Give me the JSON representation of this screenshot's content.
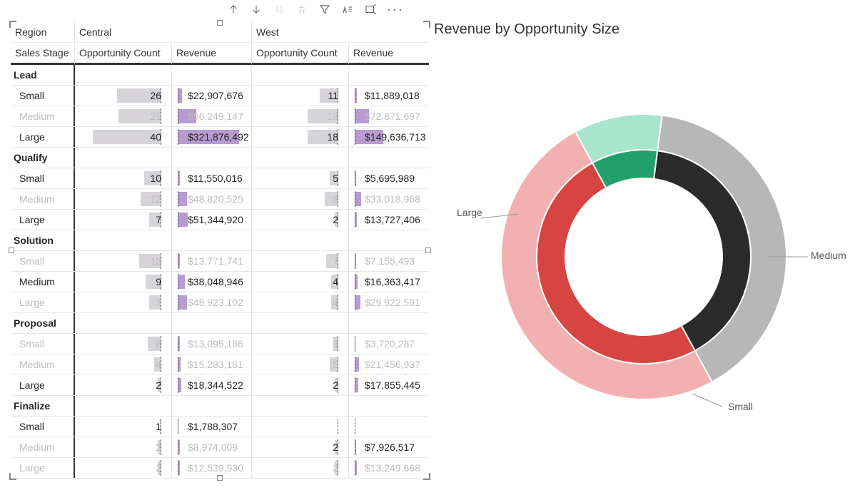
{
  "toolbar": {
    "icons": [
      "drill-up",
      "drill-down",
      "drill-hierarchy",
      "expand-down",
      "filter",
      "spotlight",
      "focus",
      "more"
    ]
  },
  "matrix": {
    "cornerLabels": {
      "region": "Region",
      "salesStage": "Sales Stage"
    },
    "regions": [
      "Central",
      "West"
    ],
    "metrics": [
      "Opportunity Count",
      "Revenue"
    ],
    "rows": [
      {
        "type": "group",
        "label": "Lead"
      },
      {
        "type": "data",
        "label": "Small",
        "dim": false,
        "c_cnt": 26,
        "c_rev": "$22,907,676",
        "w_cnt": 11,
        "w_rev": "$11,889,018",
        "c_cnt_bar": 0.52,
        "w_cnt_bar": 0.22,
        "c_rev_bar": 0.07,
        "w_rev_bar": 0.04
      },
      {
        "type": "data",
        "label": "Medium",
        "dim": true,
        "c_cnt": 25,
        "c_rev": "$96,249,147",
        "w_cnt": 18,
        "w_rev": "$72,871,697",
        "c_cnt_bar": 0.5,
        "w_cnt_bar": 0.36,
        "c_rev_bar": 0.3,
        "w_rev_bar": 0.23
      },
      {
        "type": "data",
        "label": "Large",
        "dim": false,
        "c_cnt": 40,
        "c_rev": "$321,876,492",
        "w_cnt": 18,
        "w_rev": "$149,636,713",
        "c_cnt_bar": 0.8,
        "w_cnt_bar": 0.36,
        "c_rev_bar": 1.0,
        "w_rev_bar": 0.46
      },
      {
        "type": "group",
        "label": "Qualify"
      },
      {
        "type": "data",
        "label": "Small",
        "dim": false,
        "c_cnt": 10,
        "c_rev": "$11,550,016",
        "w_cnt": 5,
        "w_rev": "$5,695,989",
        "c_cnt_bar": 0.2,
        "w_cnt_bar": 0.1,
        "c_rev_bar": 0.04,
        "w_rev_bar": 0.02
      },
      {
        "type": "data",
        "label": "Medium",
        "dim": true,
        "c_cnt": 12,
        "c_rev": "$48,820,525",
        "w_cnt": 8,
        "w_rev": "$33,018,968",
        "c_cnt_bar": 0.24,
        "w_cnt_bar": 0.16,
        "c_rev_bar": 0.15,
        "w_rev_bar": 0.1
      },
      {
        "type": "data",
        "label": "Large",
        "dim": false,
        "c_cnt": 7,
        "c_rev": "$51,344,920",
        "w_cnt": 2,
        "w_rev": "$13,727,406",
        "c_cnt_bar": 0.14,
        "w_cnt_bar": 0.04,
        "c_rev_bar": 0.16,
        "w_rev_bar": 0.04
      },
      {
        "type": "group",
        "label": "Solution"
      },
      {
        "type": "data",
        "label": "Small",
        "dim": true,
        "c_cnt": 13,
        "c_rev": "$13,771,741",
        "w_cnt": 7,
        "w_rev": "$7,155,493",
        "c_cnt_bar": 0.26,
        "w_cnt_bar": 0.14,
        "c_rev_bar": 0.04,
        "w_rev_bar": 0.02
      },
      {
        "type": "data",
        "label": "Medium",
        "dim": false,
        "c_cnt": 9,
        "c_rev": "$38,048,946",
        "w_cnt": 4,
        "w_rev": "$16,363,417",
        "c_cnt_bar": 0.18,
        "w_cnt_bar": 0.08,
        "c_rev_bar": 0.12,
        "w_rev_bar": 0.05
      },
      {
        "type": "data",
        "label": "Large",
        "dim": true,
        "c_cnt": 7,
        "c_rev": "$48,923,102",
        "w_cnt": 4,
        "w_rev": "$29,922,591",
        "c_cnt_bar": 0.14,
        "w_cnt_bar": 0.08,
        "c_rev_bar": 0.15,
        "w_rev_bar": 0.09
      },
      {
        "type": "group",
        "label": "Proposal"
      },
      {
        "type": "data",
        "label": "Small",
        "dim": true,
        "c_cnt": 8,
        "c_rev": "$13,095,186",
        "w_cnt": 3,
        "w_rev": "$3,720,287",
        "c_cnt_bar": 0.16,
        "w_cnt_bar": 0.06,
        "c_rev_bar": 0.04,
        "w_rev_bar": 0.01
      },
      {
        "type": "data",
        "label": "Medium",
        "dim": true,
        "c_cnt": 4,
        "c_rev": "$15,283,161",
        "w_cnt": 5,
        "w_rev": "$21,456,937",
        "c_cnt_bar": 0.08,
        "w_cnt_bar": 0.1,
        "c_rev_bar": 0.05,
        "w_rev_bar": 0.07
      },
      {
        "type": "data",
        "label": "Large",
        "dim": false,
        "c_cnt": 2,
        "c_rev": "$18,344,522",
        "w_cnt": 2,
        "w_rev": "$17,855,445",
        "c_cnt_bar": 0.04,
        "w_cnt_bar": 0.04,
        "c_rev_bar": 0.06,
        "w_rev_bar": 0.06
      },
      {
        "type": "group",
        "label": "Finalize"
      },
      {
        "type": "data",
        "label": "Small",
        "dim": false,
        "c_cnt": 1,
        "c_rev": "$1,788,307",
        "w_cnt": "",
        "w_rev": "",
        "c_cnt_bar": 0.02,
        "w_cnt_bar": 0,
        "c_rev_bar": 0.01,
        "w_rev_bar": 0
      },
      {
        "type": "data",
        "label": "Medium",
        "dim": true,
        "md": true,
        "c_cnt": 2,
        "c_rev": "$8,974,009",
        "w_cnt": 2,
        "w_rev": "$7,926,517",
        "c_cnt_bar": 0.04,
        "w_cnt_bar": 0.04,
        "c_rev_bar": 0.03,
        "w_rev_bar": 0.02,
        "w_active": true
      },
      {
        "type": "data",
        "label": "Large",
        "dim": true,
        "c_cnt": 2,
        "c_rev": "$12,539,930",
        "w_cnt": 2,
        "w_rev": "$13,249,668",
        "c_cnt_bar": 0.04,
        "w_cnt_bar": 0.04,
        "c_rev_bar": 0.04,
        "w_rev_bar": 0.04
      }
    ]
  },
  "chart": {
    "title": "Revenue by Opportunity Size",
    "legend": {
      "large": "Large",
      "medium": "Medium",
      "small": "Small"
    }
  },
  "chart_data": {
    "type": "pie",
    "title": "Revenue by Opportunity Size",
    "series": [
      {
        "name": "outer",
        "categories": [
          "Large",
          "Medium",
          "Small"
        ],
        "values": [
          50,
          40,
          10
        ],
        "colors": [
          "#f2b1b0",
          "#b7b7b7",
          "#a8e5ce"
        ],
        "note": "outer ring shown dimmed/unselected"
      },
      {
        "name": "inner",
        "categories": [
          "Large",
          "Medium",
          "Small"
        ],
        "values": [
          50,
          40,
          10
        ],
        "colors": [
          "#d64541",
          "#2b2b2b",
          "#22a06b"
        ],
        "note": "inner ring shown highlighted/selected"
      }
    ]
  }
}
